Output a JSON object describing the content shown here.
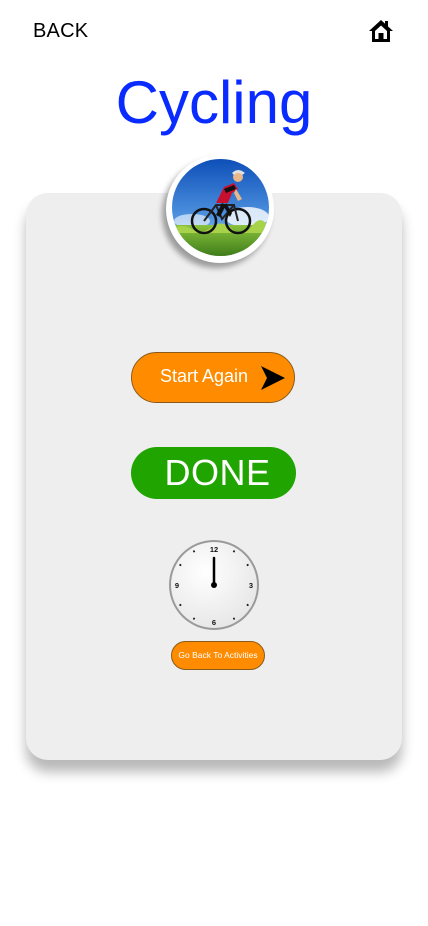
{
  "header": {
    "back_label": "BACK",
    "home_icon": "home-icon"
  },
  "page_title": "Cycling",
  "card": {
    "activity_image": "cyclist-photo",
    "start_again_label": "Start Again",
    "start_again_icon": "play-arrow-icon",
    "done_label": "DONE",
    "clock": {
      "numbers": [
        "12",
        "3",
        "6",
        "9"
      ],
      "time_shown": "12:00"
    },
    "go_back_label": "Go Back To Activities"
  },
  "colors": {
    "title": "#0a2bff",
    "orange_button": "#ff8c00",
    "green_button": "#1fa400",
    "card_bg": "#eeeeee"
  }
}
